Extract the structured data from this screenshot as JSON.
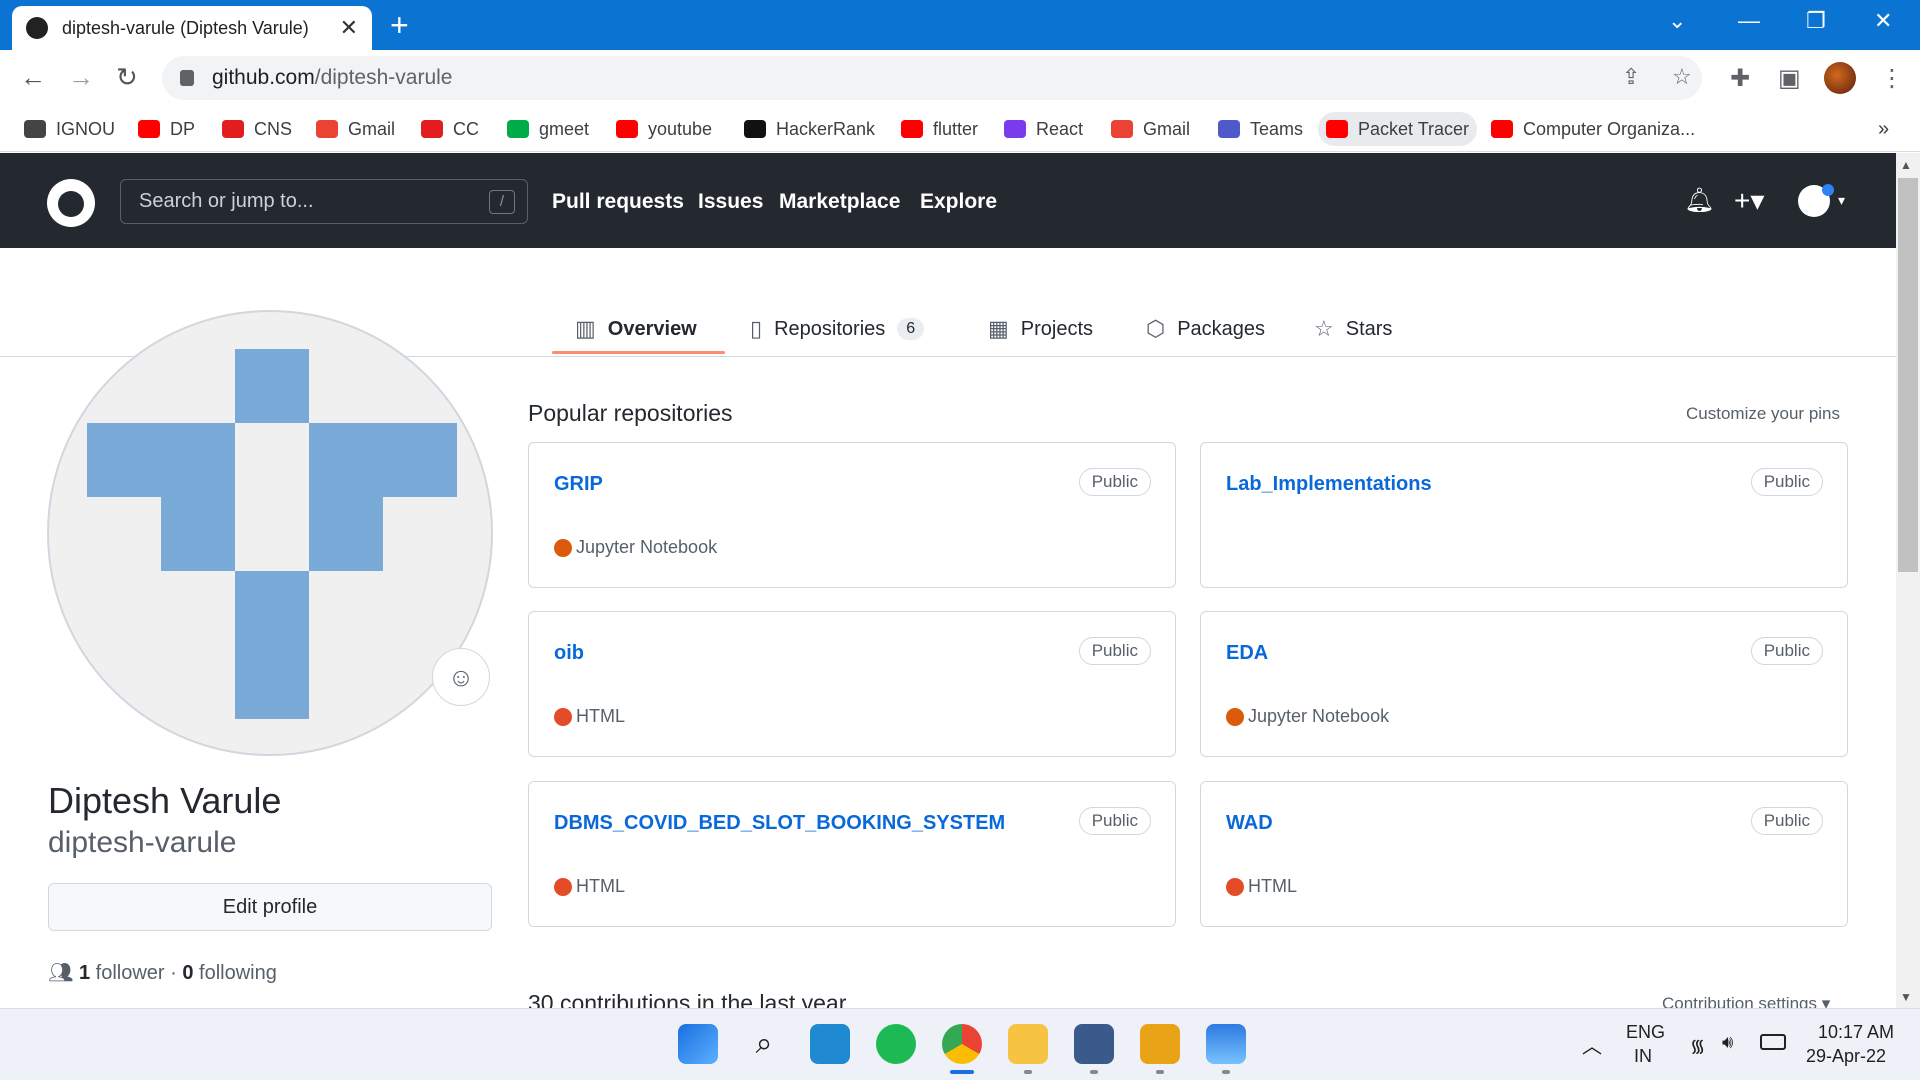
{
  "browser": {
    "tab_title": "diptesh-varule (Diptesh Varule)",
    "tab_close": "✕",
    "new_tab": "+",
    "url_host": "github.com",
    "url_path": "/diptesh-varule"
  },
  "bookmarks": [
    {
      "label": "IGNOU",
      "color": "#444444"
    },
    {
      "label": "DP",
      "color": "#ff0000"
    },
    {
      "label": "CNS",
      "color": "#e11d1d"
    },
    {
      "label": "Gmail",
      "color": "#ea4335"
    },
    {
      "label": "CC",
      "color": "#e11d1d"
    },
    {
      "label": "gmeet",
      "color": "#00ac47"
    },
    {
      "label": "youtube",
      "color": "#ff0000"
    },
    {
      "label": "HackerRank",
      "color": "#111111"
    },
    {
      "label": "flutter",
      "color": "#ff0000"
    },
    {
      "label": "React",
      "color": "#7c3aed"
    },
    {
      "label": "Gmail",
      "color": "#ea4335"
    },
    {
      "label": "Teams",
      "color": "#5059c9"
    },
    {
      "label": "Packet Tracer",
      "color": "#ff0000"
    },
    {
      "label": "Computer Organiza...",
      "color": "#ff0000"
    }
  ],
  "bookmarks_more": "»",
  "github": {
    "search_placeholder": "Search or jump to...",
    "search_shortcut": "/",
    "nav": [
      "Pull requests",
      "Issues",
      "Marketplace",
      "Explore"
    ],
    "tabs": [
      {
        "label": "Overview",
        "icon": "book-icon",
        "glyph": "📖"
      },
      {
        "label": "Repositories",
        "icon": "repo-icon",
        "glyph": "▯",
        "count": "6"
      },
      {
        "label": "Projects",
        "icon": "table-icon",
        "glyph": "▦"
      },
      {
        "label": "Packages",
        "icon": "package-icon",
        "glyph": "⬡"
      },
      {
        "label": "Stars",
        "icon": "star-icon",
        "glyph": "☆"
      }
    ]
  },
  "profile": {
    "full_name": "Diptesh Varule",
    "username": "diptesh-varule",
    "edit_button": "Edit profile",
    "followers_count": "1",
    "followers_label": "follower",
    "separator": "·",
    "following_count": "0",
    "following_label": "following"
  },
  "popular": {
    "title": "Popular repositories",
    "customize": "Customize your pins",
    "repos": [
      {
        "name": "GRIP",
        "visibility": "Public",
        "language": "Jupyter Notebook",
        "lang_color": "#da5b0b"
      },
      {
        "name": "Lab_Implementations",
        "visibility": "Public",
        "language": "",
        "lang_color": ""
      },
      {
        "name": "oib",
        "visibility": "Public",
        "language": "HTML",
        "lang_color": "#e34c26"
      },
      {
        "name": "EDA",
        "visibility": "Public",
        "language": "Jupyter Notebook",
        "lang_color": "#da5b0b"
      },
      {
        "name": "DBMS_COVID_BED_SLOT_BOOKING_SYSTEM",
        "visibility": "Public",
        "language": "HTML",
        "lang_color": "#e34c26"
      },
      {
        "name": "WAD",
        "visibility": "Public",
        "language": "HTML",
        "lang_color": "#e34c26"
      }
    ]
  },
  "contributions": {
    "title": "30 contributions in the last year",
    "settings": "Contribution settings ▾"
  },
  "taskbar": {
    "lang_top": "ENG",
    "lang_bottom": "IN",
    "time": "10:17 AM",
    "date": "29-Apr-22"
  }
}
